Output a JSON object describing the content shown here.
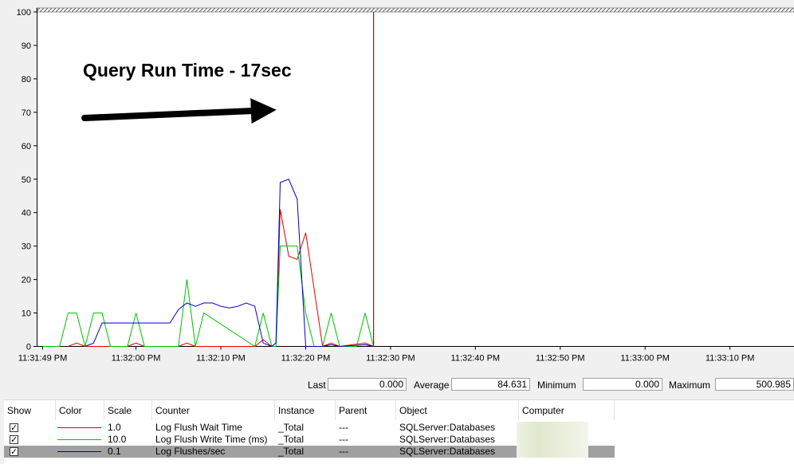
{
  "chart_data": {
    "type": "line",
    "y_ticks": [
      "0",
      "10",
      "20",
      "30",
      "40",
      "50",
      "60",
      "70",
      "80",
      "90",
      "100"
    ],
    "ylim": [
      0,
      100
    ],
    "x_ticks": [
      "11:31:49 PM",
      "11:32:00 PM",
      "11:32:10 PM",
      "11:32:20 PM",
      "11:32:30 PM",
      "11:32:40 PM",
      "11:32:50 PM",
      "11:33:00 PM",
      "11:33:10 PM"
    ],
    "x_tick_seconds": [
      0,
      11,
      21,
      31,
      41,
      51,
      61,
      71,
      81
    ],
    "xlim_seconds": [
      0,
      87
    ],
    "current_time_seconds": 39,
    "grid": false,
    "series": [
      {
        "color": "#e00000",
        "x": [
          3,
          4,
          5,
          6,
          10,
          11,
          12,
          13,
          16,
          17,
          18,
          19,
          25,
          26,
          27,
          27.5,
          28,
          29,
          30,
          31,
          33,
          34,
          35,
          38,
          39
        ],
        "values": [
          0,
          1,
          0,
          0,
          0,
          1,
          0,
          0,
          0,
          1,
          0,
          0,
          0,
          2,
          0,
          1,
          41,
          27,
          26,
          34,
          0,
          1,
          0,
          1,
          0
        ]
      },
      {
        "color": "#00c000",
        "x": [
          0,
          2,
          3,
          4,
          5,
          6,
          7,
          8,
          10,
          11,
          12,
          13,
          16,
          17,
          18,
          19,
          25,
          26,
          27,
          27.5,
          28,
          29,
          30,
          31,
          32,
          33,
          34,
          35,
          37,
          38,
          39
        ],
        "values": [
          0,
          0,
          10,
          10,
          0,
          10,
          10,
          0,
          0,
          10,
          0,
          0,
          0,
          20,
          0,
          10,
          0,
          10,
          0,
          0,
          30,
          30,
          30,
          10,
          0,
          0,
          10,
          0,
          0,
          10,
          0
        ]
      },
      {
        "color": "#0000c0",
        "x": [
          5,
          6,
          7,
          8,
          9,
          10,
          11,
          12,
          13,
          14,
          15,
          16,
          17,
          18,
          19,
          20,
          21,
          22,
          23,
          24,
          25,
          26,
          27,
          27.5,
          28,
          29,
          30,
          31,
          32,
          33,
          34,
          35,
          38,
          39
        ],
        "values": [
          0,
          1,
          7,
          7,
          7,
          7,
          7,
          7,
          7,
          7,
          7,
          11,
          13,
          12,
          13,
          13,
          12,
          11.5,
          12,
          13,
          12,
          1,
          0,
          1,
          49,
          50,
          44,
          0,
          0,
          0,
          0.5,
          0,
          0.5,
          0
        ]
      }
    ]
  },
  "annotation": {
    "text": "Query Run Time - 17sec"
  },
  "stats": {
    "last_label": "Last",
    "last_value": "0.000",
    "average_label": "Average",
    "average_value": "84.631",
    "minimum_label": "Minimum",
    "minimum_value": "0.000",
    "maximum_label": "Maximum",
    "maximum_value": "500.985"
  },
  "table": {
    "headers": [
      "Show",
      "Color",
      "Scale",
      "Counter",
      "Instance",
      "Parent",
      "Object",
      "Computer"
    ],
    "rows": [
      {
        "show": "✓",
        "color": "#e00000",
        "scale": "1.0",
        "counter": "Log Flush Wait Time",
        "instance": "_Total",
        "parent": "---",
        "object": "SQLServer:Databases",
        "computer": ""
      },
      {
        "show": "✓",
        "color": "#00c000",
        "scale": "10.0",
        "counter": "Log Flush Write Time (ms)",
        "instance": "_Total",
        "parent": "---",
        "object": "SQLServer:Databases",
        "computer": ""
      },
      {
        "show": "✓",
        "color": "#0000c0",
        "scale": "0.1",
        "counter": "Log Flushes/sec",
        "instance": "_Total",
        "parent": "---",
        "object": "SQLServer:Databases",
        "computer": ""
      }
    ]
  }
}
